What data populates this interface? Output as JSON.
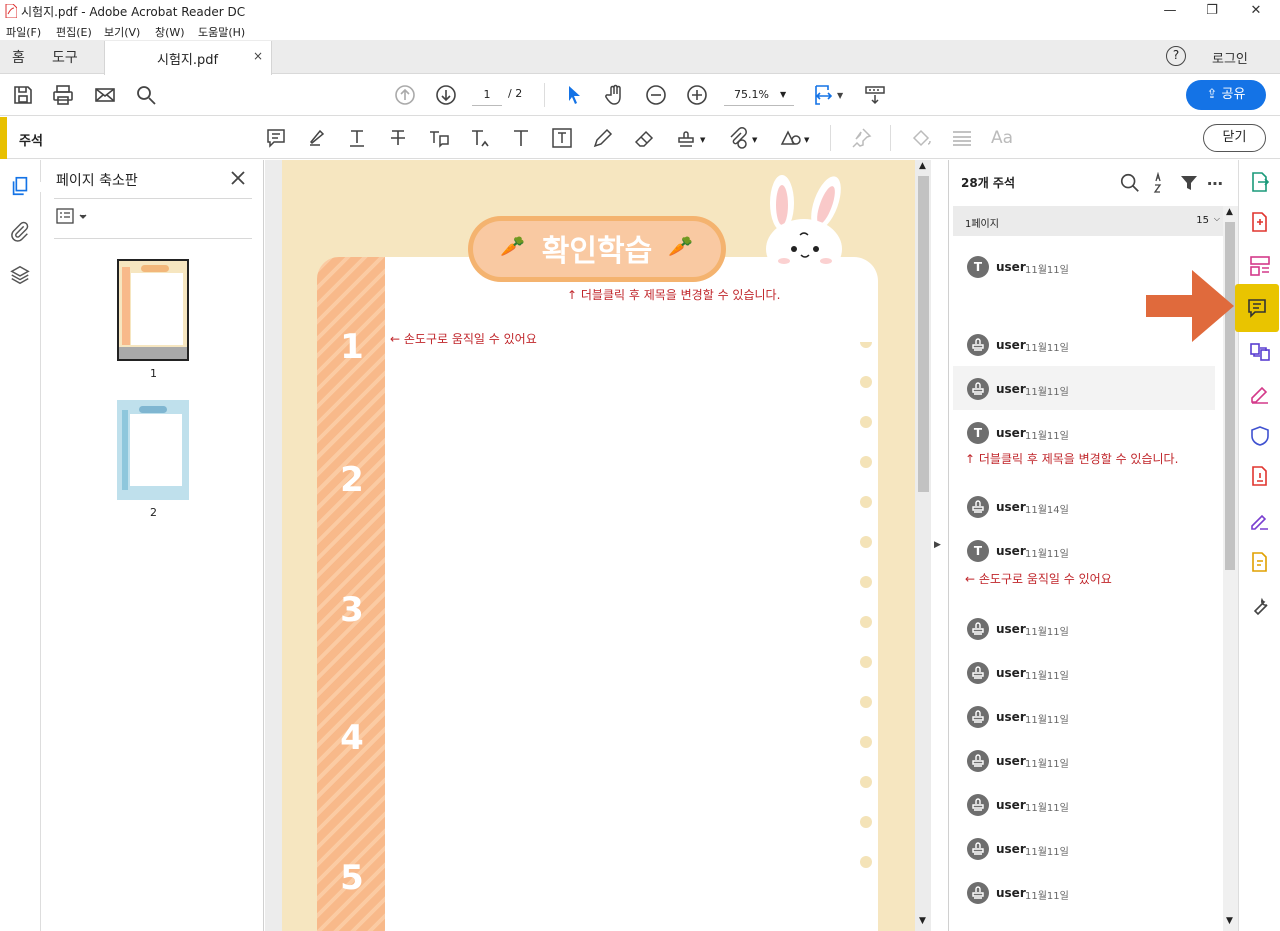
{
  "window": {
    "title": "시험지.pdf - Adobe Acrobat Reader DC",
    "minimize": "—",
    "restore": "❐",
    "close": "✕"
  },
  "menu": [
    "파일(F)",
    "편집(E)",
    "보기(V)",
    "창(W)",
    "도움말(H)"
  ],
  "tabs": {
    "home": "홈",
    "tools": "도구",
    "doc": "시험지.pdf",
    "doc_close": "×",
    "help": "?",
    "login": "로그인"
  },
  "toolbar": {
    "page_current": "1",
    "page_total": "/ 2",
    "zoom": "75.1%",
    "share": "공유"
  },
  "comment_toolbar": {
    "label": "주석",
    "text_aa": "Aa",
    "close": "닫기"
  },
  "thumb_panel": {
    "title": "페이지 축소판",
    "pages": [
      "1",
      "2"
    ]
  },
  "document": {
    "title": "확인학습",
    "hint_title": "↑ 더블클릭 후 제목을 변경할 수 있습니다.",
    "hint_move": "← 손도구로 움직일 수 있어요",
    "numbers": [
      "1",
      "2",
      "3",
      "4",
      "5"
    ]
  },
  "comments": {
    "count": "28개 주석",
    "section": "1페이지",
    "section_count": "15",
    "items": [
      {
        "avatar": "T",
        "user": "user",
        "date": "11월11일"
      },
      {
        "avatar": "",
        "user": "user",
        "date": "11월11일"
      },
      {
        "avatar": "",
        "user": "user",
        "date": "11월11일"
      },
      {
        "avatar": "T",
        "user": "user",
        "date": "11월11일"
      },
      {
        "avatar": "",
        "user": "user",
        "date": "11월14일"
      },
      {
        "avatar": "T",
        "user": "user",
        "date": "11월11일"
      },
      {
        "avatar": "",
        "user": "user",
        "date": "11월11일"
      },
      {
        "avatar": "",
        "user": "user",
        "date": "11월11일"
      },
      {
        "avatar": "",
        "user": "user",
        "date": "11월11일"
      },
      {
        "avatar": "",
        "user": "user",
        "date": "11월11일"
      },
      {
        "avatar": "",
        "user": "user",
        "date": "11월11일"
      },
      {
        "avatar": "",
        "user": "user",
        "date": "11월11일"
      },
      {
        "avatar": "",
        "user": "user",
        "date": "11월11일"
      }
    ],
    "note_title": "↑ 더블클릭 후 제목을 변경할 수 있습니다.",
    "note_move": "← 손도구로 움직일 수 있어요"
  },
  "colors": {
    "accent": "#e9c400",
    "share": "#1473e6",
    "note": "#c0262b",
    "arrow": "#e06a3c",
    "carrot": "#f8b98a"
  }
}
